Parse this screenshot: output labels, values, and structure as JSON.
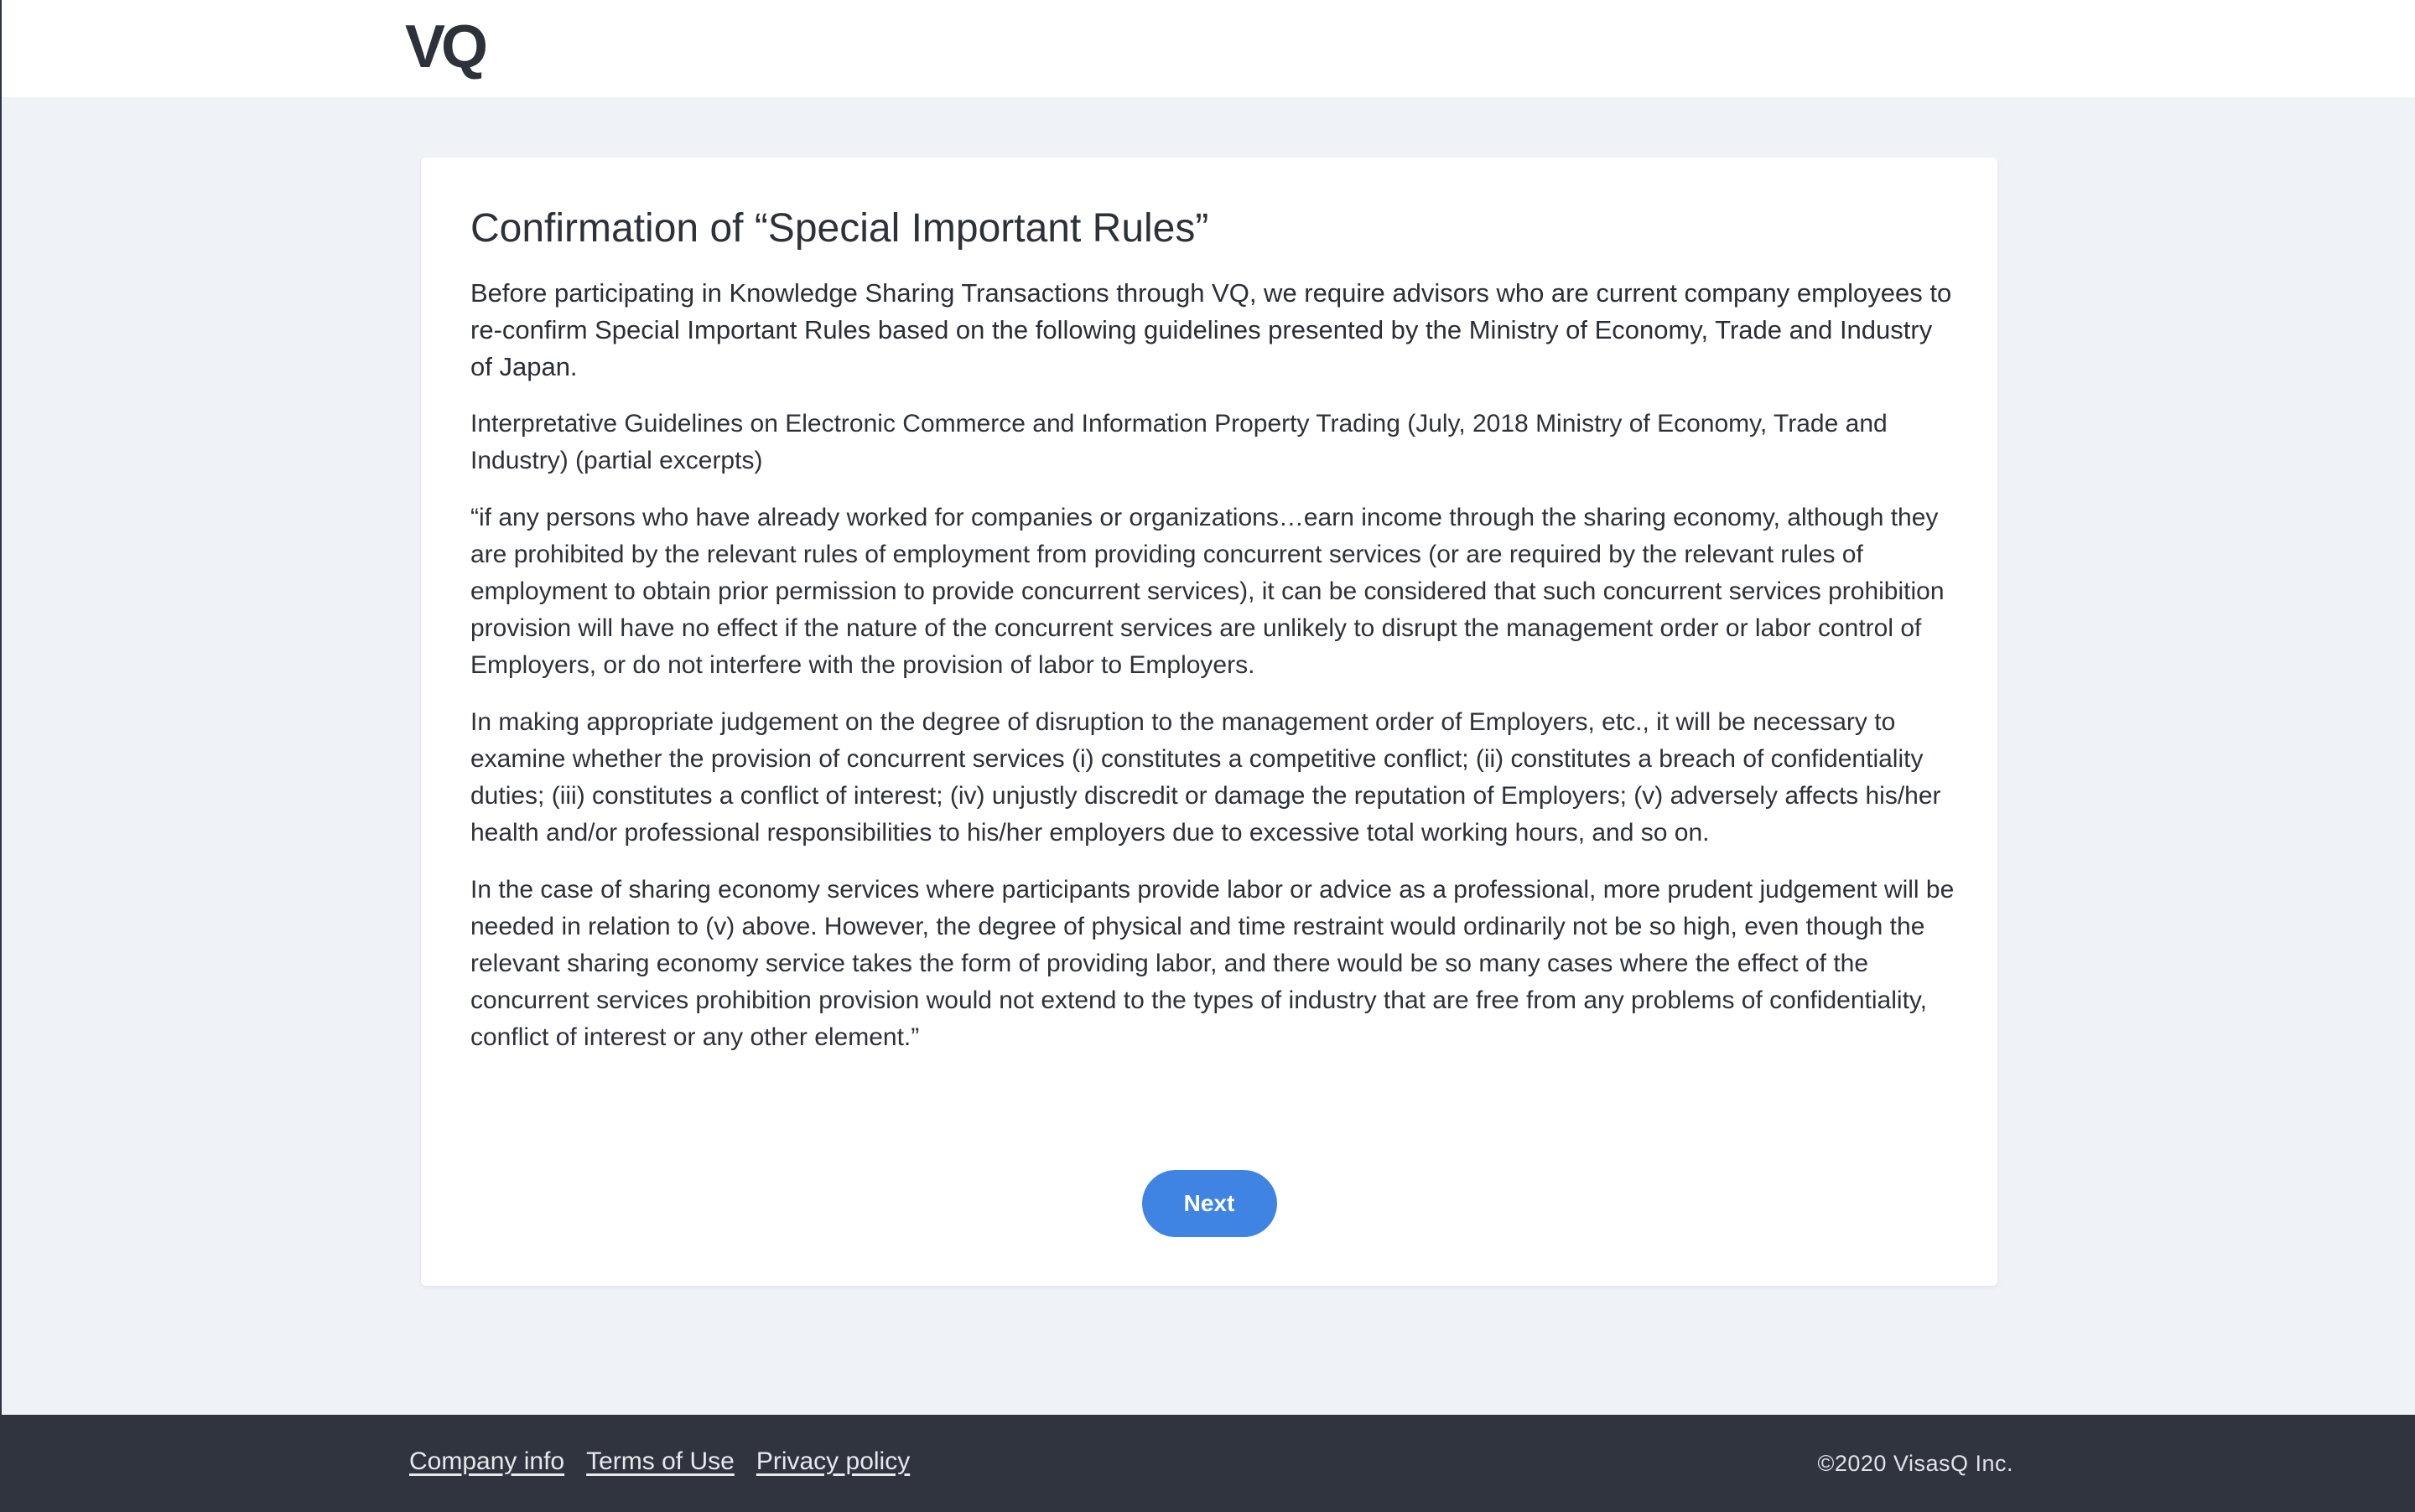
{
  "header": {
    "logo_text": "VQ"
  },
  "main": {
    "title": "Confirmation of “Special Important Rules”",
    "paragraphs": [
      "Before participating in Knowledge Sharing Transactions through VQ, we require advisors who are current company employees to re-confirm Special Important Rules based on the following guidelines presented by the Ministry of Economy, Trade and Industry of Japan.",
      "Interpretative Guidelines on Electronic Commerce and Information Property Trading (July, 2018 Ministry of Economy, Trade and Industry) (partial excerpts)",
      "“if any persons who have already worked for companies or organizations…earn income through the sharing economy, although they are prohibited by the relevant rules of employment from providing concurrent services (or are required by the relevant rules of employment to obtain prior permission to provide concurrent services), it can be considered that such concurrent services prohibition provision will have no effect if the nature of the concurrent services are unlikely to disrupt the management order or labor control of Employers, or do not interfere with the provision of labor to Employers.",
      "In making appropriate judgement on the degree of disruption to the management order of Employers, etc., it will be necessary to examine whether the provision of concurrent services (i) constitutes a competitive conflict; (ii) constitutes a breach of confidentiality duties; (iii) constitutes a conflict of interest; (iv) unjustly discredit or damage the reputation of Employers; (v) adversely affects his/her health and/or professional responsibilities to his/her employers due to excessive total working hours, and so on.",
      "In the case of sharing economy services where participants provide labor or advice as a professional, more prudent judgement will be needed in relation to (v) above. However, the degree of physical and time restraint would ordinarily not be so high, even though the relevant sharing economy service takes the form of providing labor, and there would be so many cases where the effect of the concurrent services prohibition provision would not extend to the types of industry that are free from any problems of confidentiality, conflict of interest or any other element.”"
    ],
    "next_label": "Next"
  },
  "footer": {
    "links": [
      "Company info",
      "Terms of Use",
      "Privacy policy"
    ],
    "copyright": "©2020 VisasQ Inc."
  },
  "colors": {
    "page_background": "#eff3f8",
    "accent_button": "#3f84e3",
    "footer_background": "#30343e",
    "text": "#2d313a"
  }
}
